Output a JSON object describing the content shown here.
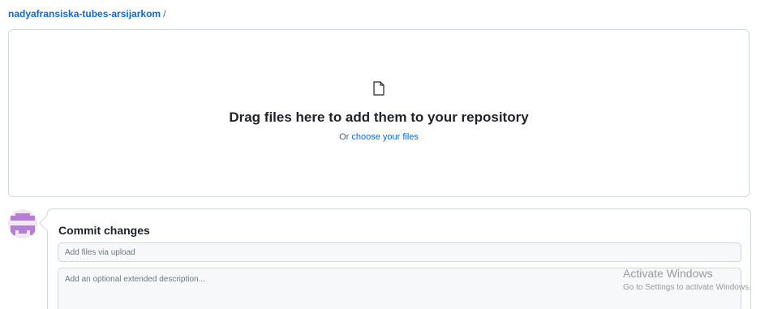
{
  "breadcrumb": {
    "repo": "nadyafransiska-tubes-arsijarkom",
    "separator": "/"
  },
  "dropzone": {
    "icon": "file-icon",
    "title": "Drag files here to add them to your repository",
    "or_text": "Or ",
    "choose_link": "choose your files"
  },
  "commit": {
    "avatar_icon": "identicon-avatar",
    "title": "Commit changes",
    "summary_placeholder": "Add files via upload",
    "description_placeholder": "Add an optional extended description..."
  },
  "watermark": {
    "title": "Activate Windows",
    "subtitle": "Go to Settings to activate Windows."
  },
  "colors": {
    "link": "#0969da",
    "border": "#d0d7de",
    "input_bg": "#f6f8fa",
    "avatar_fg": "#b77fd4"
  }
}
